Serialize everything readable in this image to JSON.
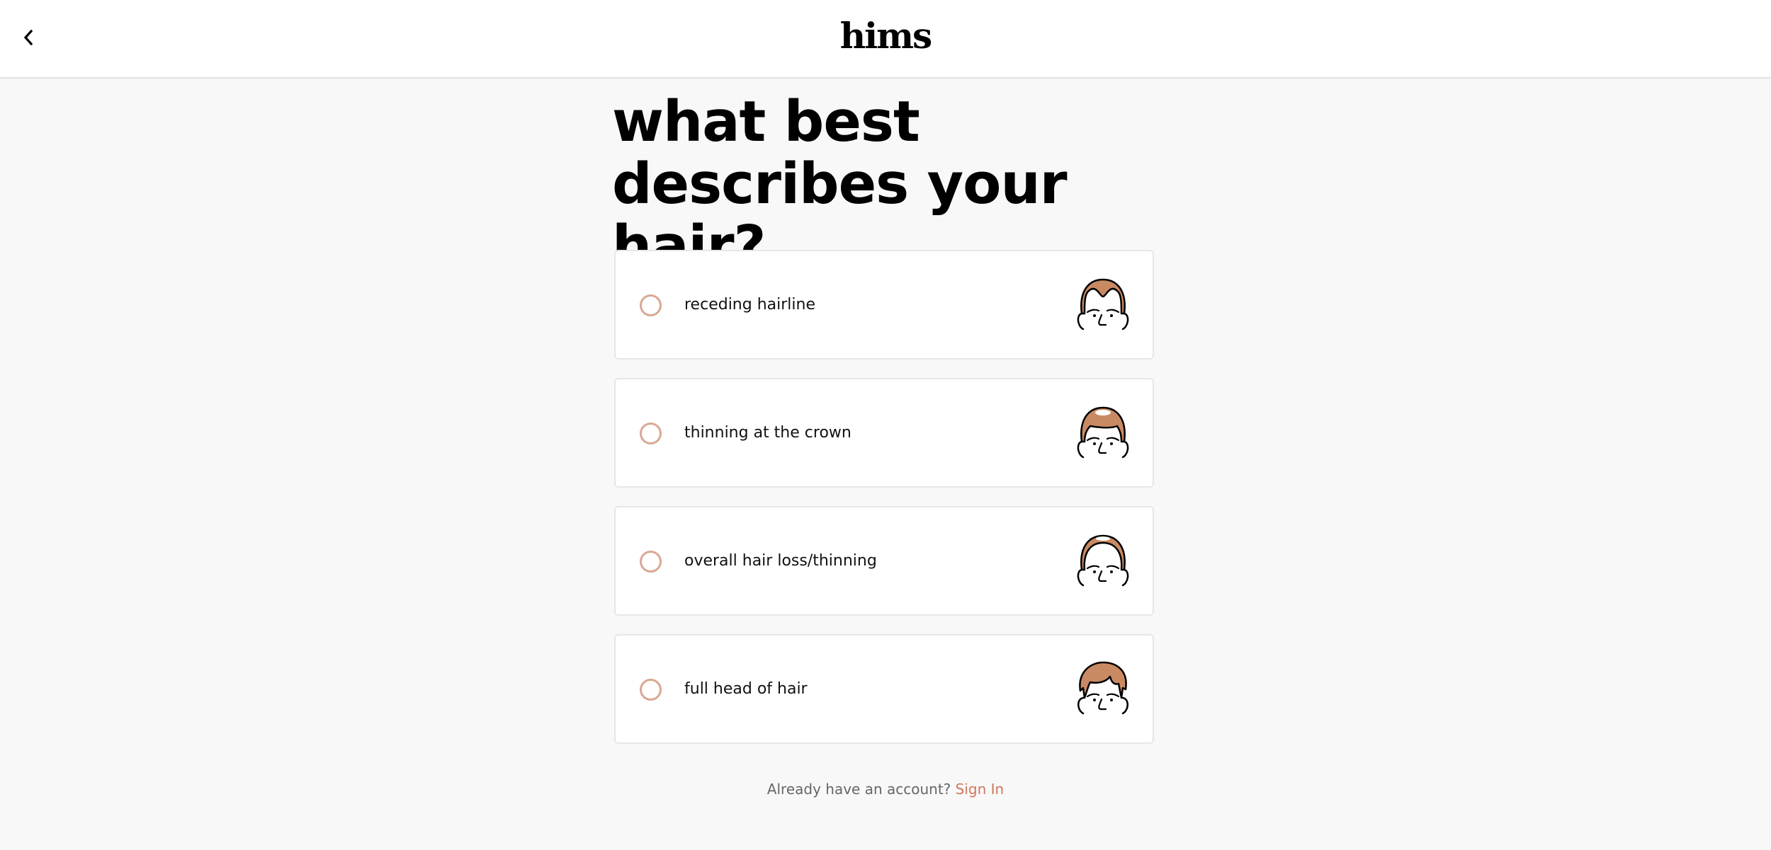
{
  "header": {
    "logo": "hims",
    "back_icon": "chevron-left-icon"
  },
  "question": {
    "title": "what best describes your hair?"
  },
  "options": [
    {
      "label": "receding hairline",
      "icon": "receding-hairline-face-icon",
      "selected": false
    },
    {
      "label": "thinning at the crown",
      "icon": "crown-thinning-face-icon",
      "selected": false
    },
    {
      "label": "overall hair loss/thinning",
      "icon": "overall-thinning-face-icon",
      "selected": false
    },
    {
      "label": "full head of hair",
      "icon": "full-hair-face-icon",
      "selected": false
    }
  ],
  "footer": {
    "prompt": "Already have an account?",
    "signin_label": "Sign In"
  },
  "colors": {
    "accent": "#d0785a",
    "radio_border": "#d9a892",
    "hair": "#c98a63",
    "background": "#f8f8f8"
  }
}
